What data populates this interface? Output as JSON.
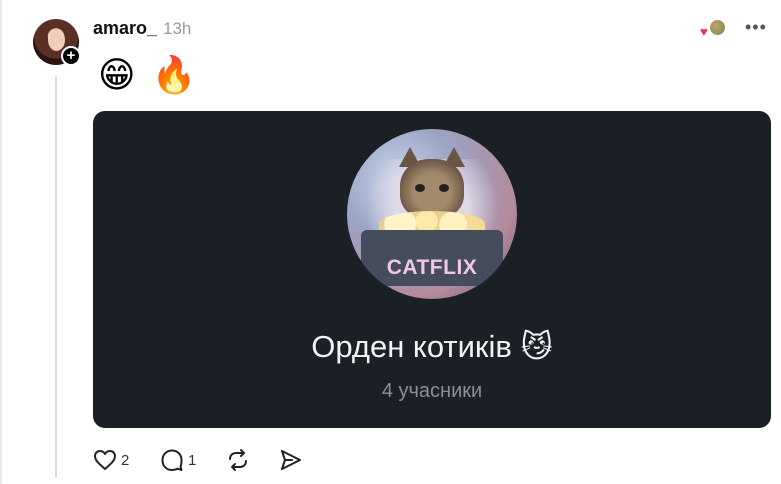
{
  "post": {
    "username": "amaro_",
    "timestamp": "13h",
    "emojis": [
      "😁",
      "🔥"
    ],
    "more_label": "•••"
  },
  "card": {
    "avatar_text": "CATFLIX",
    "title": "Орден котиків 😼",
    "subtitle": "4 учасники"
  },
  "actions": {
    "like_count": "2",
    "reply_count": "1"
  },
  "colors": {
    "card_bg": "#1b1f26",
    "heart": "#ff2a55",
    "catflix_text": "#f3c8e6"
  },
  "icons": [
    "plus-icon",
    "heart-icon",
    "comment-icon",
    "repost-icon",
    "share-icon",
    "more-icon"
  ]
}
